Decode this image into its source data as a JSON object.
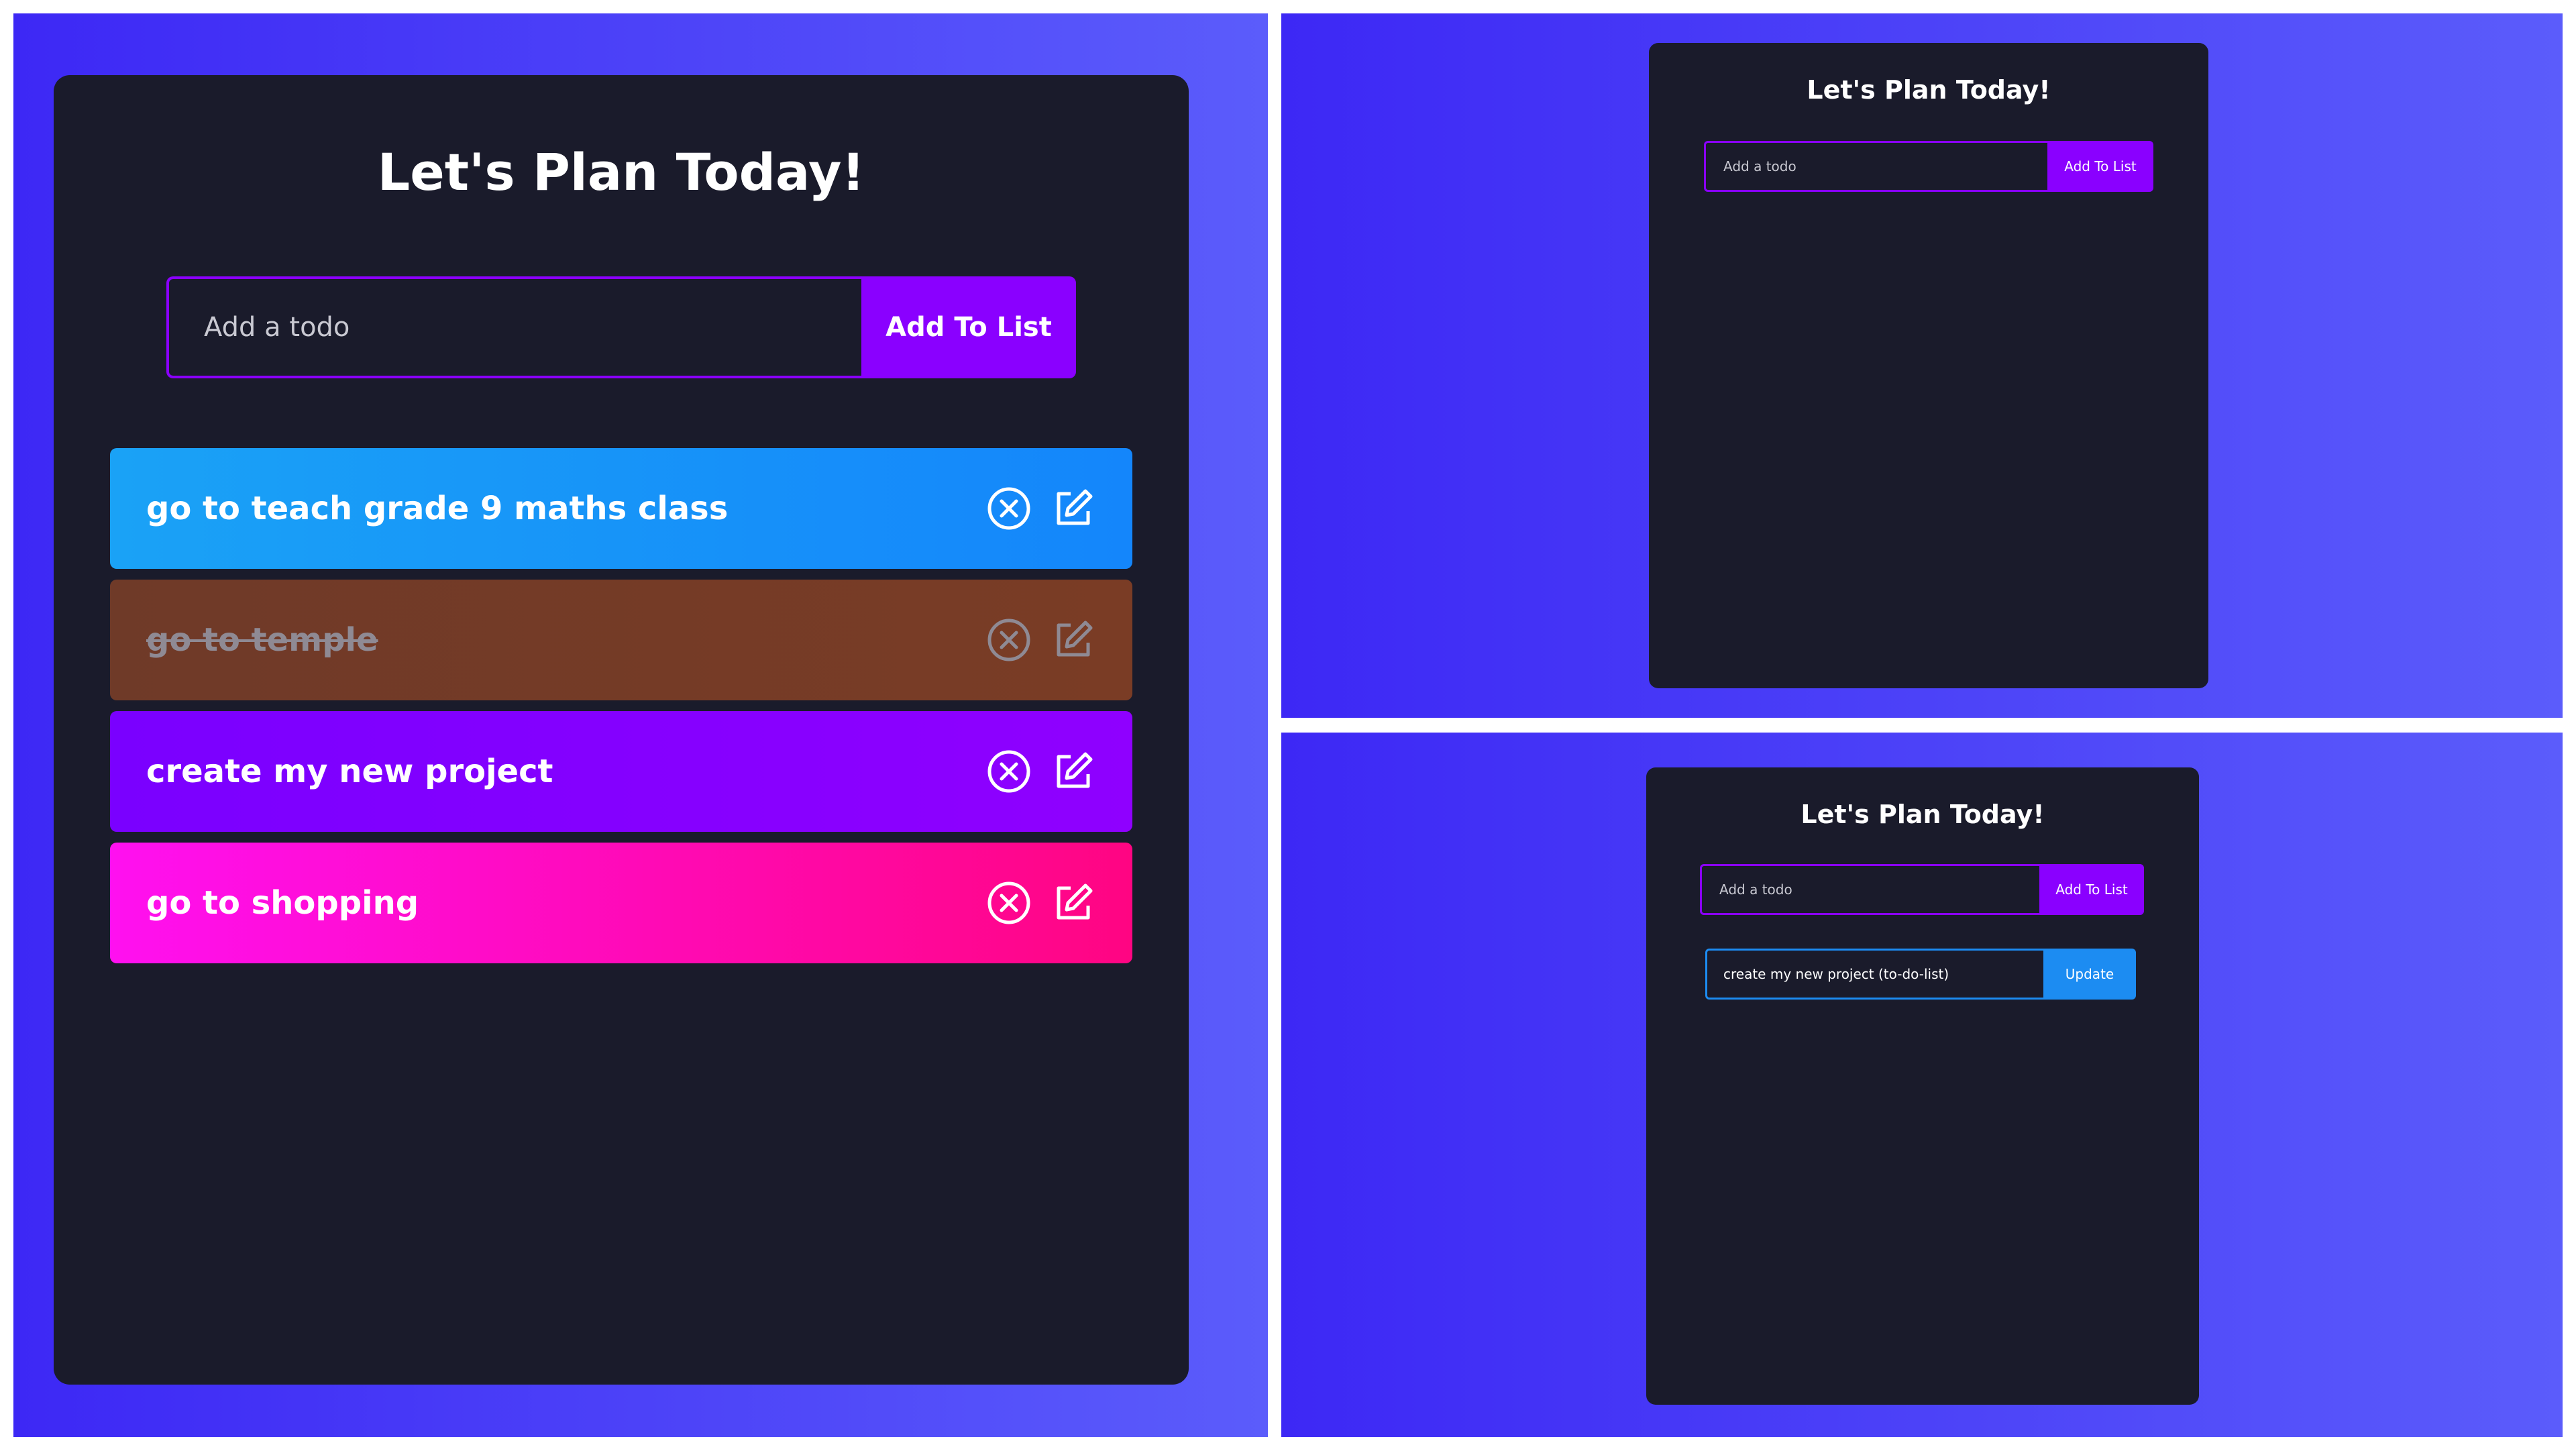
{
  "app": {
    "title": "Let's Plan Today!",
    "input_placeholder": "Add a todo",
    "add_button": "Add To List"
  },
  "todos": [
    {
      "text": "go to teach grade 9 maths class",
      "completed": false,
      "color_from": "#1aa2f6",
      "color_to": "#1486fb"
    },
    {
      "text": "go to temple",
      "completed": true,
      "color_from": "#6f3a28",
      "color_to": "#7a3c25"
    },
    {
      "text": "create my new project",
      "completed": false,
      "color_from": "#7a00ff",
      "color_to": "#8f00ff"
    },
    {
      "text": "go to shopping",
      "completed": false,
      "color_from": "#ff10f0",
      "color_to": "#ff0582"
    }
  ],
  "edit_view": {
    "edit_value": "create my new project (to-do-list)",
    "update_button": "Update"
  },
  "icons": {
    "delete": "close-circle-icon",
    "edit": "edit-icon"
  },
  "colors": {
    "background_from": "#3d28f5",
    "background_to": "#5b5cfb",
    "card": "#1a1b2b",
    "accent": "#8a00ff",
    "update_accent": "#1c8cf2"
  }
}
